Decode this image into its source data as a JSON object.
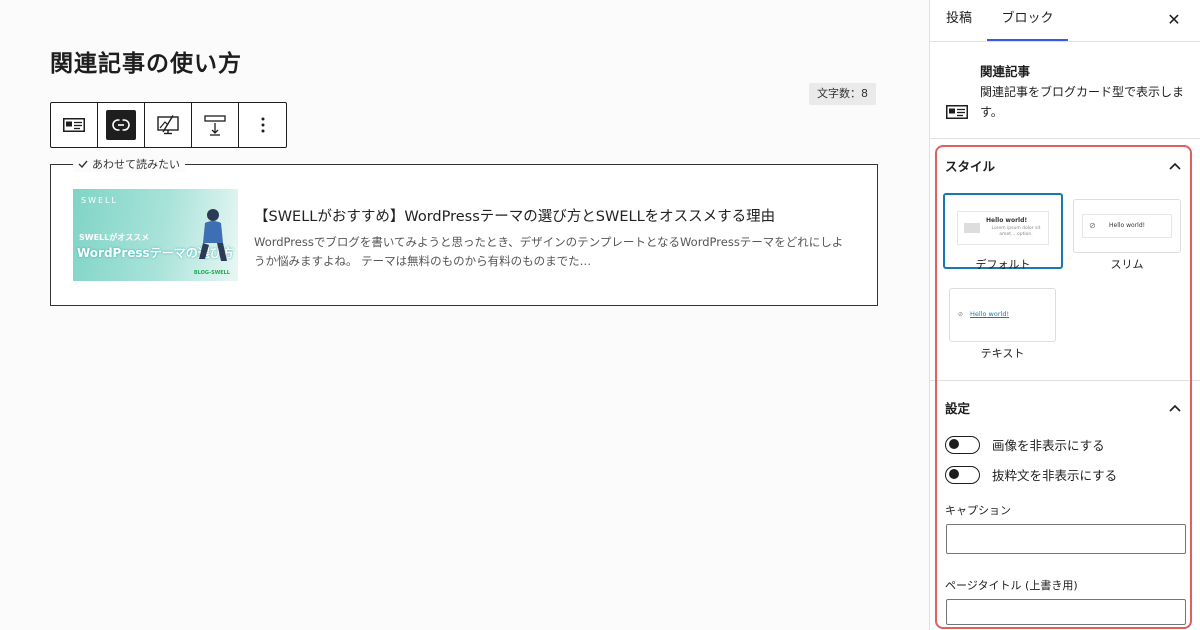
{
  "editor": {
    "page_title": "関連記事の使い方",
    "char_count": "文字数：8",
    "related": {
      "caption": "あわせて読みたい",
      "title": "【SWELLがおすすめ】WordPressテーマの選び方とSWELLをオススメする理由",
      "excerpt": "WordPressでブログを書いてみようと思ったとき、デザインのテンプレートとなるWordPressテーマをどれにしようか悩みますよね。 テーマは無料のものから有料のものまでた…",
      "thumb_logo": "SWELL",
      "thumb_line1": "SWELLがオススメ",
      "thumb_line2": "WordPressテーマの選び方",
      "thumb_line3": "BLOG-SWELL"
    }
  },
  "sidebar": {
    "tabs": [
      "投稿",
      "ブロック"
    ],
    "block": {
      "name": "関連記事",
      "description": "関連記事をブログカード型で表示します。"
    },
    "style_panel": {
      "title": "スタイル",
      "options": [
        {
          "label": "デフォルト",
          "preview_title": "Hello world!",
          "preview_text": "Lorem ipsum dolor sit amet… option."
        },
        {
          "label": "スリム",
          "preview_title": "Hello world!"
        },
        {
          "label": "テキスト",
          "preview_title": "Hello world!"
        }
      ]
    },
    "settings_panel": {
      "title": "設定",
      "toggle_hide_image": "画像を非表示にする",
      "toggle_hide_excerpt": "抜粋文を非表示にする",
      "caption_label": "キャプション",
      "page_title_label": "ページタイトル (上書き用)"
    }
  },
  "colors": {
    "accent": "#3858e9",
    "selected_style": "#1a78b0",
    "highlight": "#e06060",
    "thumb_teal": "#7fd4c6"
  }
}
